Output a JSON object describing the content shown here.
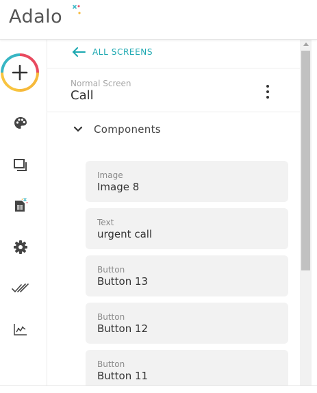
{
  "app": {
    "logo_text": "Adalo"
  },
  "colors": {
    "accent": "#1aa7b0",
    "card_bg": "#f2f2f2",
    "text": "#333333",
    "muted": "#a6a6a6"
  },
  "sidebar": {
    "add_icon": "plus-icon",
    "items": [
      {
        "icon": "palette-icon"
      },
      {
        "icon": "screens-icon"
      },
      {
        "icon": "database-icon"
      },
      {
        "icon": "gear-icon"
      },
      {
        "icon": "double-check-icon"
      },
      {
        "icon": "analytics-icon"
      }
    ]
  },
  "panel": {
    "back_label": "ALL SCREENS",
    "screen_type": "Normal Screen",
    "screen_name": "Call",
    "section_label": "Components",
    "components": [
      {
        "type": "Image",
        "name": "Image 8"
      },
      {
        "type": "Text",
        "name": "urgent call"
      },
      {
        "type": "Button",
        "name": "Button 13"
      },
      {
        "type": "Button",
        "name": "Button 12"
      },
      {
        "type": "Button",
        "name": "Button 11"
      }
    ]
  }
}
